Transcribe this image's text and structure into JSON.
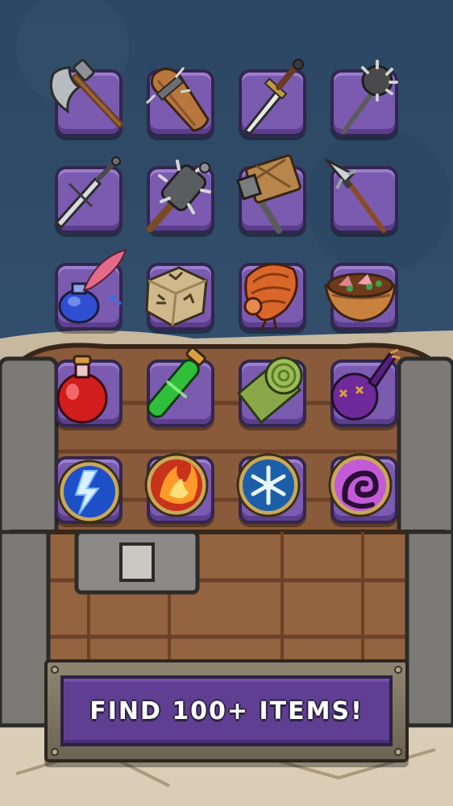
{
  "banner": {
    "text": "FIND 100+ ITEMS!"
  },
  "colors": {
    "background": "#2f4a66",
    "slot_fill": "#7a5bb0",
    "slot_border": "#33264e",
    "banner_fill": "#5e3f92",
    "banner_frame": "#8f8571"
  },
  "inventory": {
    "rows": [
      {
        "items": [
          {
            "icon": "battle-axe-icon"
          },
          {
            "icon": "wooden-club-icon"
          },
          {
            "icon": "short-sword-icon"
          },
          {
            "icon": "morning-star-icon"
          }
        ]
      },
      {
        "items": [
          {
            "icon": "long-sword-icon"
          },
          {
            "icon": "spiked-mace-icon"
          },
          {
            "icon": "war-hammer-icon"
          },
          {
            "icon": "spear-icon"
          }
        ]
      },
      {
        "items": [
          {
            "icon": "ink-quill-icon"
          },
          {
            "icon": "rune-die-icon"
          },
          {
            "icon": "shell-creature-icon"
          },
          {
            "icon": "food-bowl-icon"
          }
        ]
      },
      {
        "items": [
          {
            "icon": "red-potion-icon"
          },
          {
            "icon": "green-vial-icon"
          },
          {
            "icon": "scroll-roll-icon"
          },
          {
            "icon": "purple-pouch-icon"
          }
        ]
      },
      {
        "items": [
          {
            "icon": "lightning-rune-icon"
          },
          {
            "icon": "fire-rune-icon"
          },
          {
            "icon": "frost-rune-icon"
          },
          {
            "icon": "shadow-rune-icon"
          }
        ]
      }
    ]
  }
}
